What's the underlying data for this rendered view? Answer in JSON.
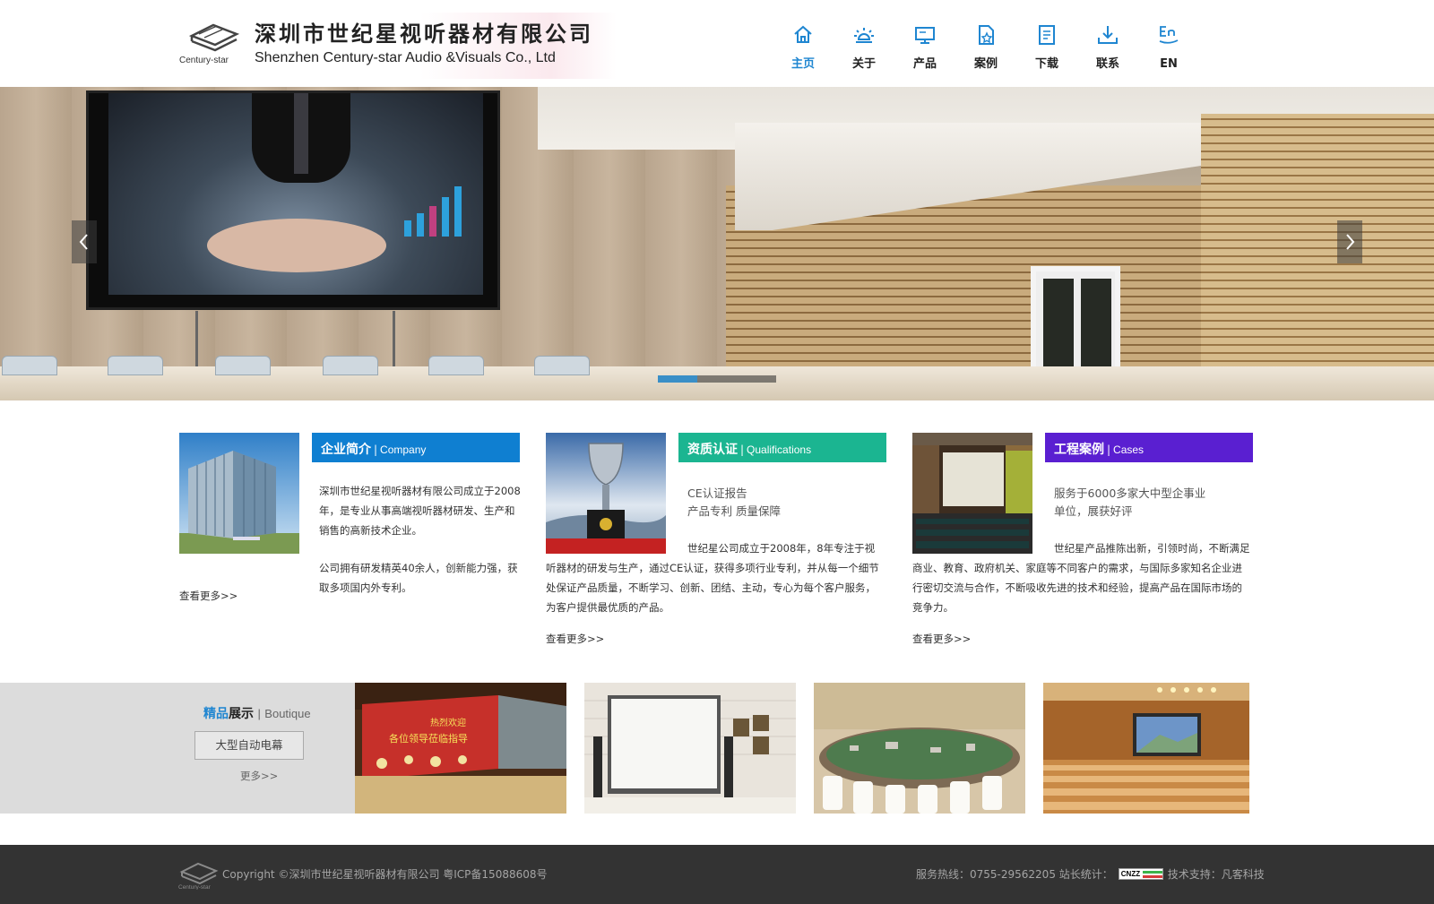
{
  "header": {
    "logo_brand_small": "Century-star",
    "logo_cn": "深圳市世纪星视听器材有限公司",
    "logo_en": "Shenzhen Century-star Audio &Visuals Co., Ltd"
  },
  "nav": {
    "items": [
      {
        "label": "主页",
        "icon": "home-icon",
        "active": true
      },
      {
        "label": "关于",
        "icon": "bulb-icon",
        "active": false
      },
      {
        "label": "产品",
        "icon": "monitor-icon",
        "active": false
      },
      {
        "label": "案例",
        "icon": "doc-star-icon",
        "active": false
      },
      {
        "label": "下载",
        "icon": "document-icon",
        "active": false
      },
      {
        "label": "联系",
        "icon": "download-icon",
        "active": false
      },
      {
        "label": "EN",
        "icon": "en-icon",
        "active": false
      }
    ],
    "active_color": "#1f86d1"
  },
  "banner": {
    "slides": 3,
    "active_slide": 1
  },
  "company": {
    "title_cn": "企业简介",
    "title_en": "Company",
    "color": "#0f7fd1",
    "p1": "深圳市世纪星视听器材有限公司成立于2008年，是专业从事高端视听器材研发、生产和销售的高新技术企业。",
    "p2": "公司拥有研发精英40余人，创新能力强，获取多项国内外专利。",
    "more": "查看更多>>"
  },
  "qualifications": {
    "title_cn": "资质认证",
    "title_en": "Qualifications",
    "color": "#1bb591",
    "sub1": "CE认证报告",
    "sub2": "产品专利 质量保障",
    "p": "世纪星公司成立于2008年，8年专注于视听器材的研发与生产，通过CE认证，获得多项行业专利，并从每一个细节处保证产品质量，不断学习、创新、团结、主动，专心为每个客户服务，为客户提供最优质的产品。",
    "more": "查看更多>>"
  },
  "cases": {
    "title_cn": "工程案例",
    "title_en": "Cases",
    "color": "#5a1fd1",
    "sub1": "服务于6000多家大中型企事业",
    "sub2": "单位，展获好评",
    "p": "世纪星产品推陈出新，引领时尚，不断满足商业、教育、政府机关、家庭等不同客户的需求，与国际多家知名企业进行密切交流与合作，不断吸收先进的技术和经验，提高产品在国际市场的竞争力。",
    "more": "查看更多>>"
  },
  "boutique": {
    "title_a": "精品",
    "title_b": "展示",
    "title_en": "Boutique",
    "button": "大型自动电幕",
    "more": "更多>>",
    "thumb_text": "热烈欢迎\n各位领导莅临指导"
  },
  "footer": {
    "copyright": "Copyright ©深圳市世纪星视听器材有限公司 粤ICP备15088608号",
    "hotline": "服务热线：0755-29562205 站长统计：",
    "badge": "CNZZ",
    "support": "技术支持：凡客科技"
  }
}
